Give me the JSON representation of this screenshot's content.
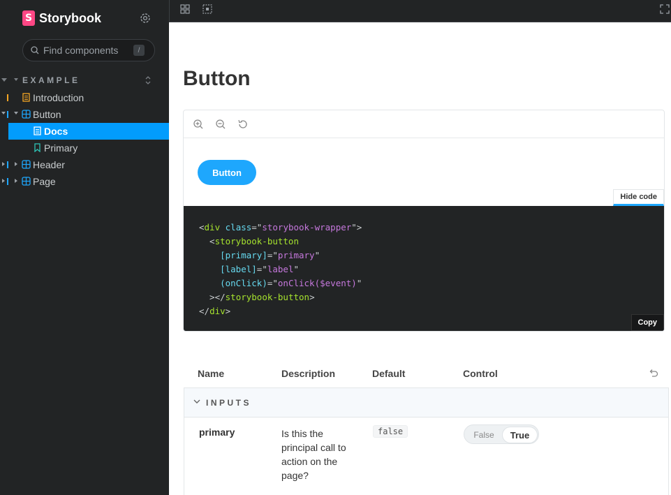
{
  "sidebar": {
    "brand": "Storybook",
    "search_placeholder": "Find components",
    "search_shortcut": "/",
    "group": "EXAMPLE",
    "items": [
      {
        "label": "Introduction",
        "icon": "document-icon"
      },
      {
        "label": "Button",
        "icon": "component-icon"
      },
      {
        "label": "Docs",
        "icon": "document-icon",
        "selected": true
      },
      {
        "label": "Primary",
        "icon": "bookmark-icon"
      },
      {
        "label": "Header",
        "icon": "component-icon"
      },
      {
        "label": "Page",
        "icon": "component-icon"
      }
    ]
  },
  "main": {
    "title": "Button",
    "preview_button_label": "Button",
    "hide_code_label": "Hide code",
    "copy_label": "Copy"
  },
  "args_table": {
    "headers": [
      "Name",
      "Description",
      "Default",
      "Control"
    ],
    "section": "INPUTS",
    "rows": [
      {
        "name": "primary",
        "description": "Is this the principal call to action on the page?",
        "default": "false",
        "control": {
          "options": [
            "False",
            "True"
          ],
          "selected": "True"
        }
      }
    ]
  },
  "colors": {
    "sidebar_bg": "#222425",
    "accent": "#029cfd",
    "button": "#1ea7fd",
    "brand": "#ff4785"
  }
}
